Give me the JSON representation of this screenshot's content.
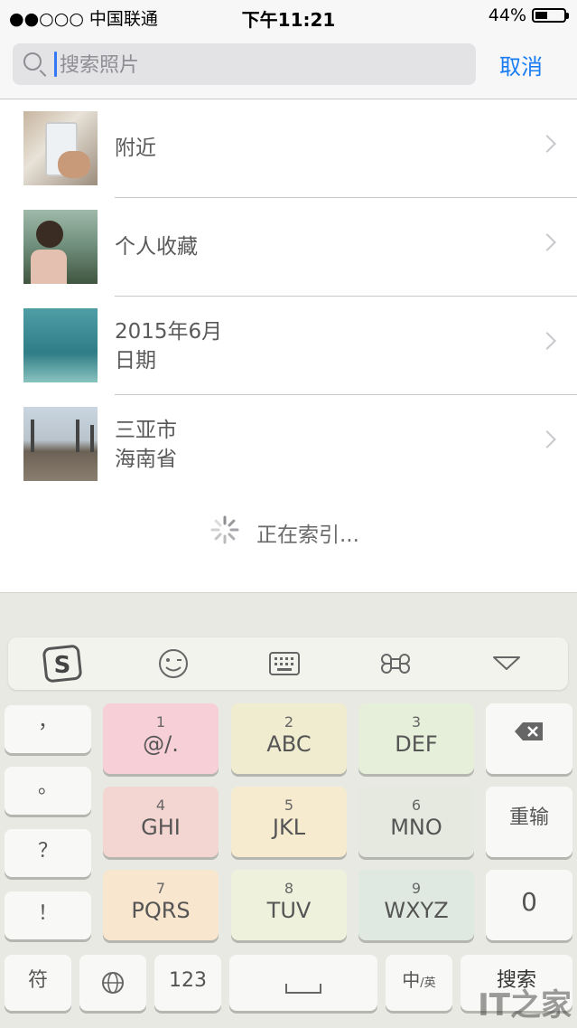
{
  "status_bar": {
    "carrier": "●●○○○ 中国联通",
    "time": "下午11:21",
    "battery": "44%",
    "battery_level": 0.44
  },
  "search": {
    "placeholder": "搜索照片",
    "cancel": "取消"
  },
  "results": [
    {
      "line1": "附近",
      "line2": ""
    },
    {
      "line1": "个人收藏",
      "line2": ""
    },
    {
      "line1": "2015年6月",
      "line2": "日期"
    },
    {
      "line1": "三亚市",
      "line2": "海南省"
    }
  ],
  "indexing": "正在索引...",
  "keyboard": {
    "toolbar": [
      "sogou-logo-icon",
      "emoji-icon",
      "keyboard-icon",
      "command-icon",
      "collapse-icon"
    ],
    "left_col": [
      "，",
      "。",
      "？",
      "！"
    ],
    "nine": [
      {
        "n": "1",
        "m": "@/.",
        "color": "#f7cfd6"
      },
      {
        "n": "2",
        "m": "ABC",
        "color": "#f0ecd0"
      },
      {
        "n": "3",
        "m": "DEF",
        "color": "#e6efd9"
      },
      {
        "n": "4",
        "m": "GHI",
        "color": "#f3d6d1"
      },
      {
        "n": "5",
        "m": "JKL",
        "color": "#f6ebcf"
      },
      {
        "n": "6",
        "m": "MNO",
        "color": "#e6e9df"
      },
      {
        "n": "7",
        "m": "PQRS",
        "color": "#f8e6cf"
      },
      {
        "n": "8",
        "m": "TUV",
        "color": "#eef2dc"
      },
      {
        "n": "9",
        "m": "WXYZ",
        "color": "#dfe9e1"
      }
    ],
    "right_col": {
      "reinput": "重输",
      "zero": "0"
    },
    "bottom": {
      "symbols": "符",
      "numbers": "123",
      "lang_main": "中",
      "lang_sub": "/英",
      "search": "搜索"
    }
  },
  "watermark": "IT之家"
}
